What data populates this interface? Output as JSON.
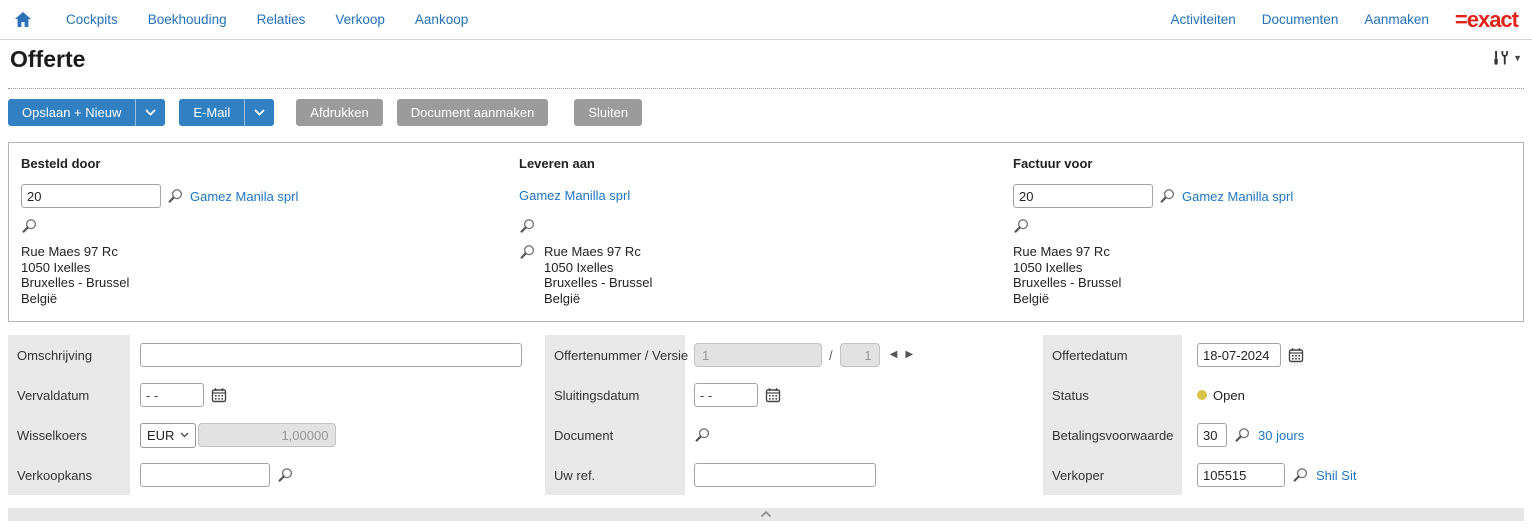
{
  "nav": {
    "left_items": [
      {
        "label": "Cockpits"
      },
      {
        "label": "Boekhouding"
      },
      {
        "label": "Relaties"
      },
      {
        "label": "Verkoop"
      },
      {
        "label": "Aankoop"
      }
    ],
    "right_items": [
      {
        "label": "Activiteiten"
      },
      {
        "label": "Documenten"
      },
      {
        "label": "Aanmaken"
      }
    ],
    "logo_text": "=exact"
  },
  "page": {
    "title": "Offerte"
  },
  "toolbar": {
    "save_new_label": "Opslaan + Nieuw",
    "email_label": "E-Mail",
    "print_label": "Afdrukken",
    "create_document_label": "Document aanmaken",
    "close_label": "Sluiten"
  },
  "parties": {
    "ordered_by": {
      "title": "Besteld door",
      "code": "20",
      "name_link": "Gamez Manila sprl",
      "address": [
        "Rue Maes 97 Rc",
        "1050 Ixelles",
        "Bruxelles - Brussel",
        "België"
      ]
    },
    "deliver_to": {
      "title": "Leveren aan",
      "name_link": "Gamez Manilla sprl",
      "address": [
        "Rue Maes 97 Rc",
        "1050 Ixelles",
        "Bruxelles - Brussel",
        "België"
      ]
    },
    "invoice_to": {
      "title": "Factuur voor",
      "code": "20",
      "name_link": "Gamez Manilla sprl",
      "address": [
        "Rue Maes 97 Rc",
        "1050 Ixelles",
        "Bruxelles - Brussel",
        "België"
      ]
    }
  },
  "form": {
    "left": {
      "description_label": "Omschrijving",
      "description_value": "",
      "expiry_label": "Vervaldatum",
      "expiry_value": "- -",
      "currency_label": "Wisselkoers",
      "currency_selected": "EUR",
      "exchange_rate_value": "1,00000",
      "opportunity_label": "Verkoopkans",
      "opportunity_value": ""
    },
    "middle": {
      "number_label": "Offertenummer / Versie",
      "number_value": "1",
      "separator": "/",
      "version_value": "1",
      "closing_label": "Sluitingsdatum",
      "closing_value": "- -",
      "document_label": "Document",
      "your_ref_label": "Uw ref.",
      "your_ref_value": ""
    },
    "right": {
      "date_label": "Offertedatum",
      "date_value": "18-07-2024",
      "status_label": "Status",
      "status_value": "Open",
      "payment_label": "Betalingsvoorwaarde",
      "payment_code": "30",
      "payment_link": "30 jours",
      "salesperson_label": "Verkoper",
      "salesperson_code": "105515",
      "salesperson_link": "Shil Sit"
    }
  },
  "colors": {
    "button_blue": "#3080c2",
    "button_gray": "#9b9b9b",
    "link_blue": "#1d76c2",
    "logo_red": "#e2231a",
    "label_bg": "#e8e8e8",
    "status_open_yellow": "#d9c445"
  }
}
